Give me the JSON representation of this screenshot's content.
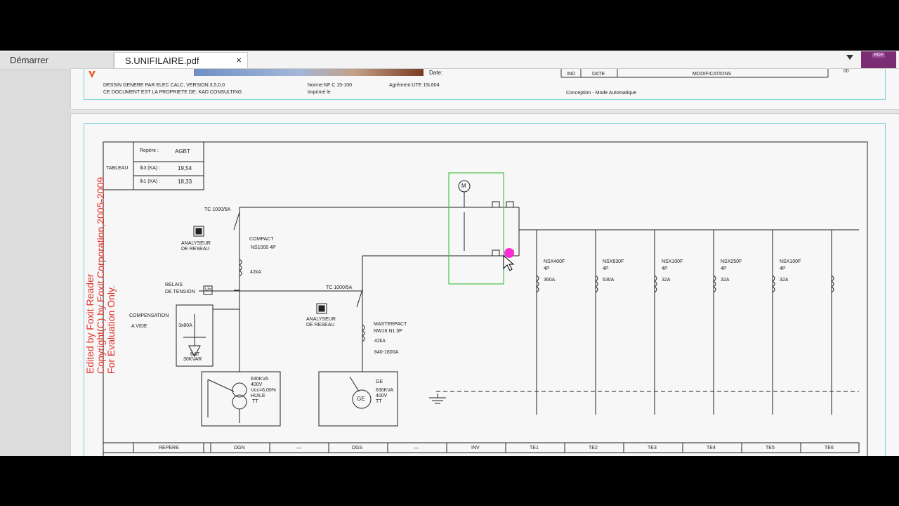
{
  "tabs": [
    {
      "label": "Démarrer",
      "active": false
    },
    {
      "label": "S.UNIFILAIRE.pdf",
      "active": true
    }
  ],
  "tab_close_symbol": "×",
  "page1_header": {
    "date_label": "Date:",
    "ind": "IND",
    "date_col": "DATE",
    "modifications": "MODIFICATIONS",
    "rev": "00",
    "line1": "DESSIN GENERE PAR ELEC CALC, VERSION:3,5,0,0",
    "line2": "CE DOCUMENT EST LA PROPRIETE DE: KAD CONSULTING",
    "norme": "Norme:NF C 15-100",
    "agrement": "Agrément:UTE 15L604",
    "imprime": "Imprimé le",
    "conception": "Conception - Mode Automatique"
  },
  "info_table": {
    "tableau": "TABLEAU",
    "repere_label": "Repère :",
    "repere_value": "AGBT",
    "ik3_label": "Ik3 (KA) :",
    "ik3_value": "19,54",
    "ik1_label": "Ik1 (KA) :",
    "ik1_value": "18,33"
  },
  "labels": {
    "tc1": "TC 1000/5A",
    "tc2": "TC 1000/5A",
    "analyseur1": [
      "ANALYSEUR",
      "DE RESEAU"
    ],
    "analyseur2": [
      "ANALYSEUR",
      "DE RESEAU"
    ],
    "compact": [
      "COMPACT",
      "NS1000 4P",
      "42kA"
    ],
    "relais": [
      "RELAIS",
      "DE TENSION"
    ],
    "relais_box": "U>",
    "compensation": [
      "COMPENSATION",
      "A VIDE"
    ],
    "comp_box": [
      "3x80A",
      "BAT",
      "30KVAR"
    ],
    "transfo": [
      "630KVA",
      "400V",
      "Ucc=6,00%",
      "HUILE",
      "TT"
    ],
    "masterpact": [
      "MASTERPACT",
      "NW16 N1 3P",
      "42kA",
      "640-1600A"
    ],
    "ge_info": [
      "GE",
      "630KVA",
      "400V",
      "TT"
    ],
    "ge_circle": "GE",
    "motor": "M"
  },
  "feeders": [
    {
      "name": "NSX400F",
      "poles": "4P",
      "rating": "360A"
    },
    {
      "name": "NSX630F",
      "poles": "4P",
      "rating": "630A"
    },
    {
      "name": "NSX100F",
      "poles": "4P",
      "rating": "32A"
    },
    {
      "name": "NSX250F",
      "poles": "4P",
      "rating": "32A"
    },
    {
      "name": "NSX100F",
      "poles": "4P",
      "rating": "32A"
    },
    {
      "name": "",
      "poles": "",
      "rating": ""
    }
  ],
  "bottom_table": {
    "repere": "REPERE",
    "cells": [
      "DGN",
      "—",
      "DGS",
      "—",
      "INV",
      "TE1",
      "TE2",
      "TE3",
      "TE4",
      "TE5",
      "TE6"
    ]
  },
  "watermark": [
    "Edited by Foxit Reader",
    "Copyright(C) by Foxit Corporation,2005-2009",
    "For Evaluation Only."
  ],
  "brand_label": "PDF",
  "colors": {
    "accent": "#7b2d73",
    "cursor": "#ff2bd6",
    "frame": "#7fd1dc",
    "watermark": "#e0332b",
    "selection": "#4cc24c"
  }
}
